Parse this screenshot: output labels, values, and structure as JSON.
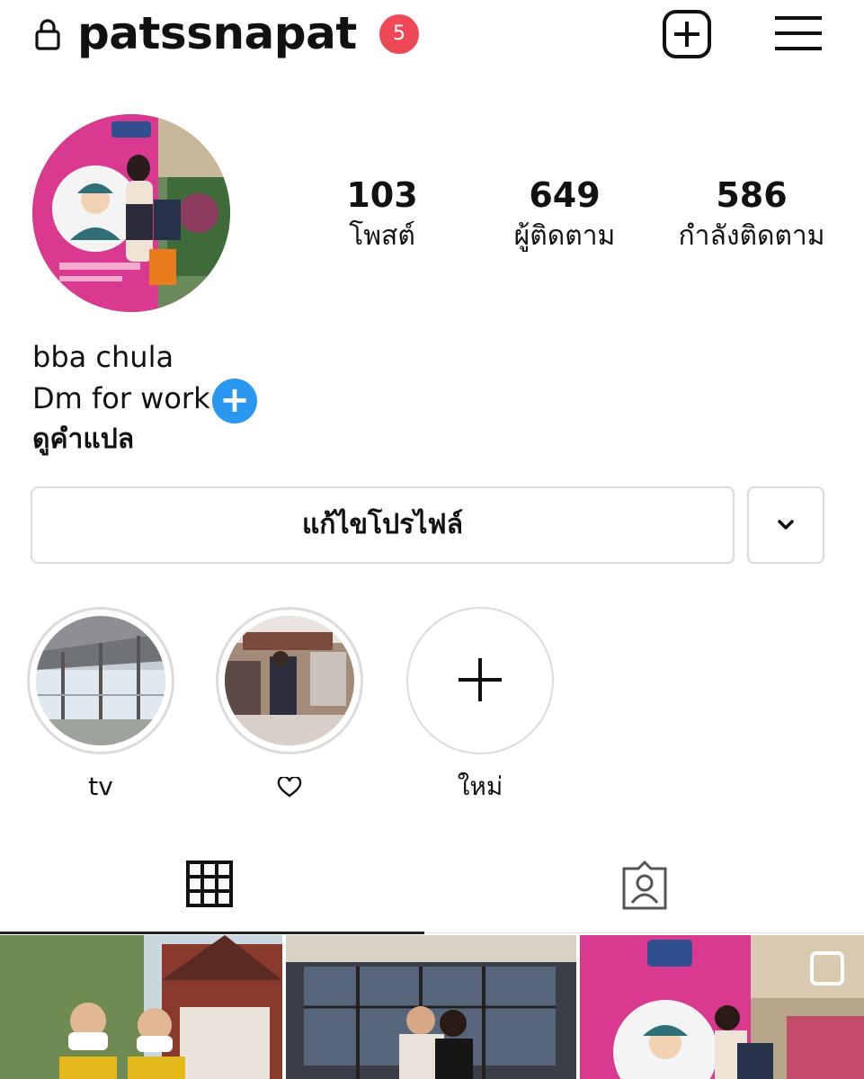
{
  "header": {
    "username": "patssnapat",
    "notification_count": "5",
    "icons": {
      "lock": "lock-icon",
      "new_post": "plus-square-icon",
      "menu": "hamburger-menu-icon"
    }
  },
  "profile": {
    "stats": [
      {
        "count": "103",
        "label": "โพสต์"
      },
      {
        "count": "649",
        "label": "ผู้ติดตาม"
      },
      {
        "count": "586",
        "label": "กำลังติดตาม"
      }
    ],
    "bio": {
      "line1": "bba chula",
      "line2": "Dm for work",
      "translate_link": "ดูคำแปล"
    },
    "edit_profile_label": "แก้ไขโปรไฟล์"
  },
  "highlights": [
    {
      "label": "tv"
    },
    {
      "label": "♡"
    },
    {
      "label": "ใหม่"
    }
  ],
  "tabs": [
    {
      "icon": "grid-icon",
      "active": true
    },
    {
      "icon": "tagged-person-icon",
      "active": false
    }
  ],
  "colors": {
    "notification_badge": "#ed4956",
    "add_story_blue": "#2a97f0",
    "border": "#dbdbdb",
    "avatar_pink": "#d93a8f"
  }
}
